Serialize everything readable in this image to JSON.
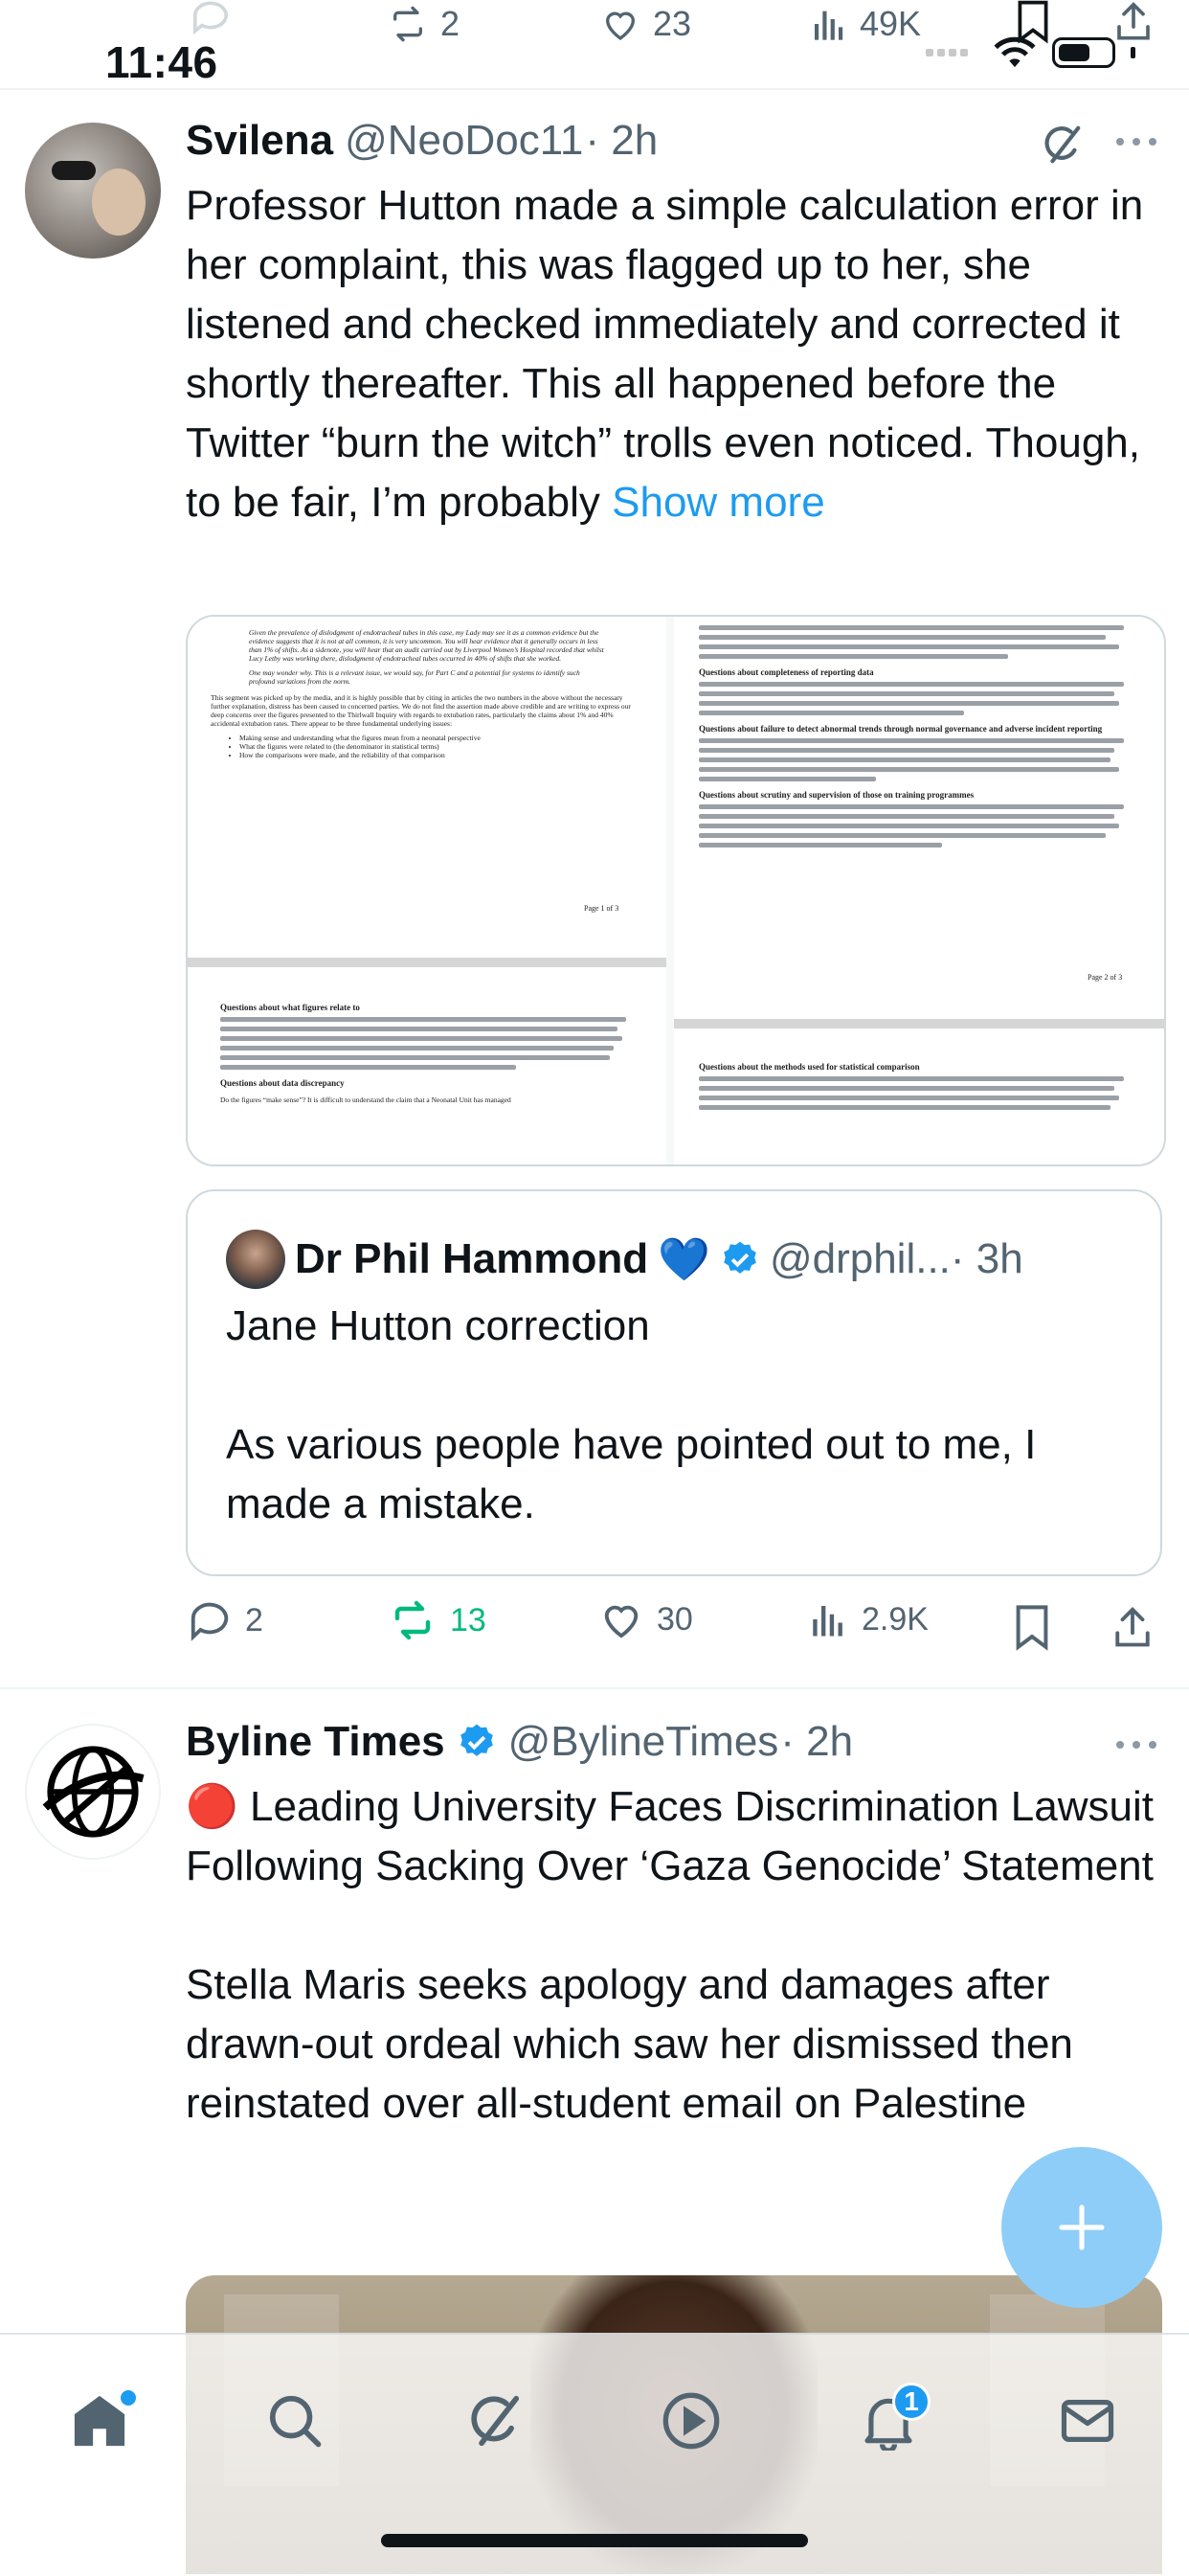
{
  "status_bar": {
    "time": "11:46"
  },
  "prev_tweet_actions": {
    "retweets": "2",
    "likes": "23",
    "views": "49K"
  },
  "tweet1": {
    "name": "Svilena",
    "handle": "@NeoDoc11",
    "time": "· 2h",
    "text": "Professor Hutton made a simple calculation error in her complaint, this was flagged up to her, she listened and checked immediately and corrected it shortly thereafter. This all happened before the Twitter “burn the witch” trolls even noticed. Though, to be fair, I’m probably ",
    "show_more": "Show more",
    "doc": {
      "p1_intro": "Given the prevalence of dislodgment of endotracheal tubes in this case, my Lady may see it as a common evidence but the evidence suggests that it is not at all common, it is very uncommon. You will hear evidence that it generally occurs in less than 1% of shifts. As a sidenote, you will hear that an audit carried out by Liverpool Women’s Hospital recorded that whilst Lucy Letby was working there, dislodgment of endotracheal tubes occurred in 40% of shifts that she worked.",
      "p1_italic": "One may wonder why. This is a relevant issue, we would say, for Part C and a potential for systems to identify such profound variations from the norm.",
      "p1_body": "This segment was picked up by the media, and it is highly possible that by citing in articles the two numbers in the above without the necessary further explanation, distress has been caused to concerned parties. We do not find the assertion made above credible and are writing to express our deep concerns over the figures presented to the Thirlwall Inquiry with regards to extubation rates, particularly the claims about 1% and 40% accidental extubation rates. There appear to be three fundamental underlying issues:",
      "p1_bullets": [
        "Making sense and understanding what the figures mean from a neonatal perspective",
        "What the figures were related to (the denominator in statistical terms)",
        "How the comparisons were made, and the reliability of that comparison"
      ],
      "p1_page": "Page 1 of 3",
      "p2_heading1": "Questions about completeness of reporting data",
      "p2_heading2": "Questions about failure to detect abnormal trends through normal governance and adverse incident reporting",
      "p2_heading3": "Questions about scrutiny and supervision of those on training programmes",
      "p2_page": "Page 2 of 3",
      "p3_heading1": "Questions about what figures relate to",
      "p3_heading2": "Questions about data discrepancy",
      "p3_last": "Do the figures “make sense”? It is difficult to understand the claim that a Neonatal Unit has managed",
      "p4_heading1": "Questions about the methods used for statistical comparison"
    },
    "quote": {
      "name": "Dr Phil Hammond",
      "emoji": "💙",
      "handle": "@drphil...",
      "time": "· 3h",
      "line1": "Jane Hutton correction",
      "line2": "As various people have pointed out to me, I made a mistake."
    },
    "actions": {
      "replies": "2",
      "retweets": "13",
      "likes": "30",
      "views": "2.9K"
    }
  },
  "tweet2": {
    "name": "Byline Times",
    "handle": "@BylineTimes",
    "time": "· 2h",
    "headline": "🔴 Leading University Faces Discrimination Lawsuit Following Sacking Over ‘Gaza Genocide’ Statement",
    "body": "Stella Maris seeks apology and damages after drawn-out ordeal which saw her dismissed then reinstated over all-student email on Palestine"
  },
  "tabbar": {
    "notifications_badge": "1"
  },
  "colors": {
    "accent": "#1d9bf0",
    "retweet_active": "#00ba7c",
    "secondary_text": "#536471",
    "fab": "#8ecdf8"
  }
}
